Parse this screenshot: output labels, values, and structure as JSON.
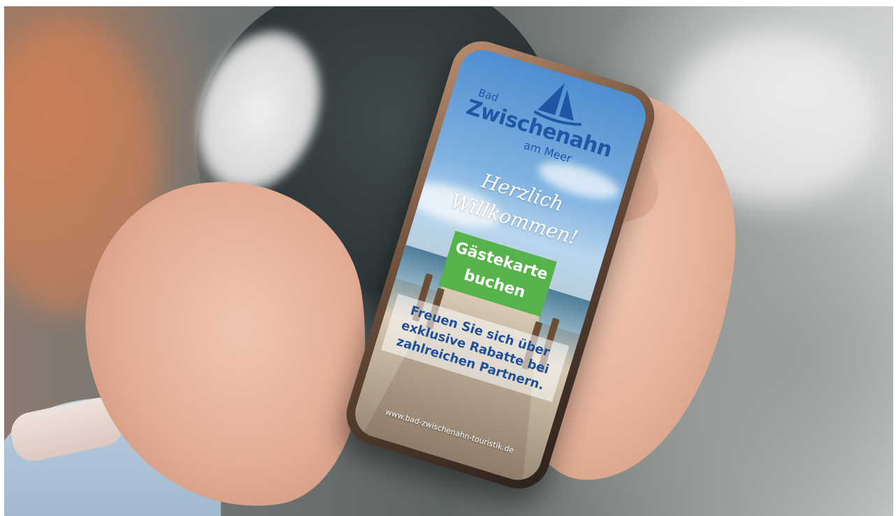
{
  "app": {
    "logo_small": "Bad",
    "logo_main": "Zwischenahn",
    "logo_sub": "am Meer",
    "welcome_line1": "Herzlich",
    "welcome_line2": "Willkommen!",
    "cta_line1": "Gästekarte",
    "cta_line2": "buchen",
    "promo_text": "Freuen Sie sich über exklusive Rabatte bei zahlreichen Partnern.",
    "url": "www.bad-zwischenahn-touristik.de"
  },
  "colors": {
    "brand_blue": "#1e57a6",
    "cta_green": "#56b24a",
    "welcome_white": "#ffffff"
  }
}
